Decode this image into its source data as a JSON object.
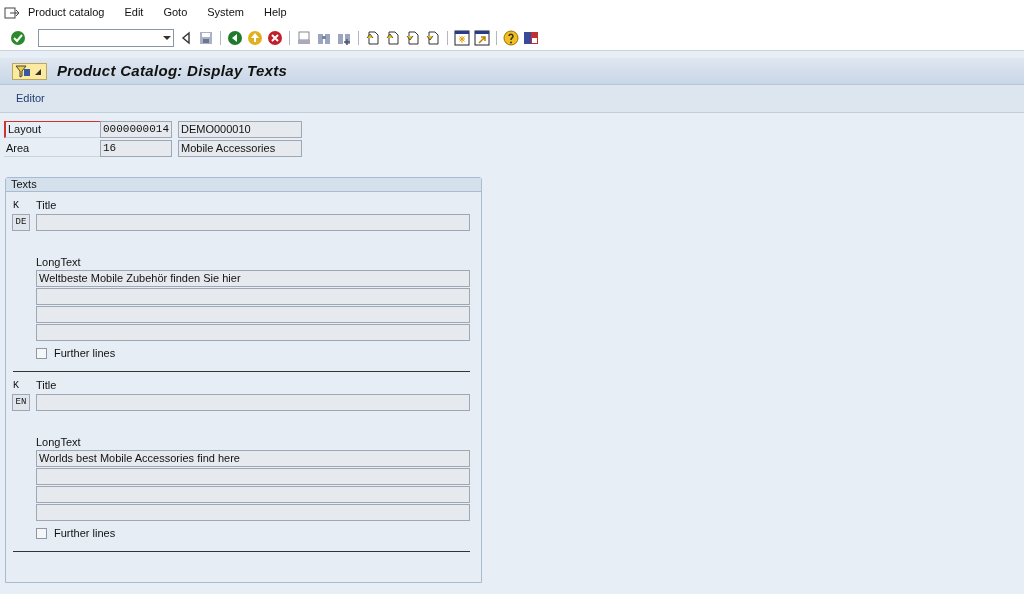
{
  "menu": [
    "Product catalog",
    "Edit",
    "Goto",
    "System",
    "Help"
  ],
  "title": "Product Catalog: Display Texts",
  "app_toolbar": [
    "Editor"
  ],
  "header_fields": [
    {
      "label": "Layout",
      "focused": true,
      "values": [
        "0000000014",
        "DEMO000010"
      ]
    },
    {
      "label": "Area",
      "focused": false,
      "values": [
        "16",
        "Mobile Accessories"
      ]
    }
  ],
  "texts_group": {
    "title": "Texts",
    "sections": [
      {
        "key_label": "K",
        "language": "DE",
        "title_label": "Title",
        "longtext_label": "LongText",
        "lines": [
          "Weltbeste Mobile Zubehör finden Sie hier"
        ],
        "further_lines": {
          "label": "Further lines",
          "checked": false
        }
      },
      {
        "key_label": "K",
        "language": "EN",
        "title_label": "Title",
        "longtext_label": "LongText",
        "lines": [
          "Worlds best Mobile Accessories find here"
        ],
        "further_lines": {
          "label": "Further lines",
          "checked": false
        }
      }
    ]
  }
}
